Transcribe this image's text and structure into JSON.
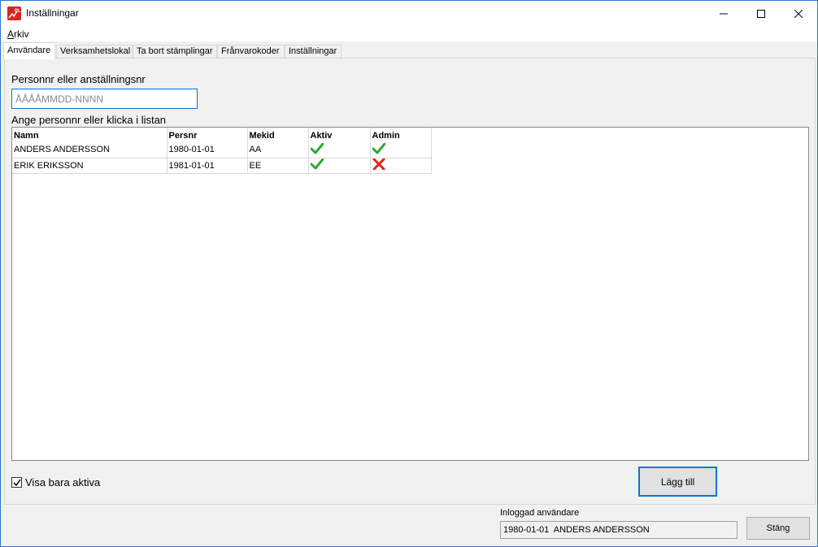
{
  "window": {
    "title": "Inställningar"
  },
  "menu": {
    "arkiv_first": "A",
    "arkiv_rest": "rkiv"
  },
  "tabs": [
    {
      "label": "Användare",
      "active": true
    },
    {
      "label": "Verksamhetslokal",
      "active": false
    },
    {
      "label": "Ta bort stämplingar",
      "active": false
    },
    {
      "label": "Frånvarokoder",
      "active": false
    },
    {
      "label": "Inställningar",
      "active": false
    }
  ],
  "form": {
    "persnr_label": "Personnr eller anställningsnr",
    "persnr_placeholder": "ÅÅÅÅMMDD-NNNN",
    "list_label": "Ange personnr eller klicka i listan"
  },
  "table": {
    "headers": [
      "Namn",
      "Persnr",
      "Mekid",
      "Aktiv",
      "Admin"
    ],
    "rows": [
      {
        "namn": "ANDERS ANDERSSON",
        "persnr": "1980-01-01",
        "mekid": "AA",
        "aktiv": "check-icon",
        "admin": "check-icon"
      },
      {
        "namn": "ERIK ERIKSSON",
        "persnr": "1981-01-01",
        "mekid": "EE",
        "aktiv": "check-icon",
        "admin": "cross-icon"
      }
    ]
  },
  "filter": {
    "label": "Visa bara aktiva",
    "checked": true
  },
  "buttons": {
    "add": "Lägg till",
    "close": "Stäng"
  },
  "status": {
    "logged_label": "Inloggad användare",
    "logged_value": "1980-01-01  ANDERS ANDERSSON"
  },
  "colors": {
    "accent": "#0078d7",
    "check": "#2ea82e",
    "cross": "#d9261c"
  }
}
